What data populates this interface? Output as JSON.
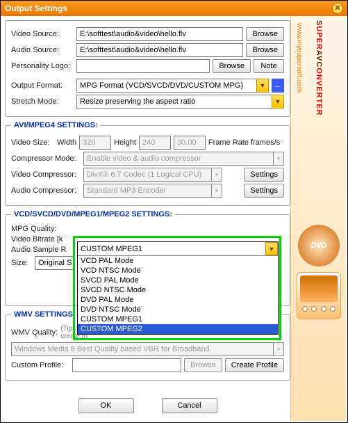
{
  "window": {
    "title": "Output Settings"
  },
  "brand": {
    "name_a": "S",
    "name_b": "UPER",
    "name_c": "AVC",
    "name_d": "ONVERTER",
    "url": "www.mysupersoft.com",
    "dvd": "DVD"
  },
  "top": {
    "video_source_label": "Video Source:",
    "video_source_value": "E:\\softtest\\audio&video\\hello.flv",
    "audio_source_label": "Audio Source:",
    "audio_source_value": "E:\\softtest\\audio&video\\hello.flv",
    "personality_logo_label": "Personality Logo:",
    "personality_logo_value": "",
    "browse": "Browse",
    "note": "Note",
    "output_format_label": "Output Format:",
    "output_format_value": "MPG Format (VCD/SVCD/DVD/CUSTOM MPG)",
    "stretch_mode_label": "Stretch Mode:",
    "stretch_mode_value": "Resize preserving the aspect ratio"
  },
  "avi": {
    "legend": "AVI/MPEG4 SETTINGS:",
    "video_size": "Video Size:",
    "width": "Width",
    "width_val": "320",
    "height": "Height",
    "height_val": "240",
    "fps_val": "30.00",
    "fps_label": "Frame Rate frames/s",
    "compressor_mode": "Compressor Mode:",
    "compressor_mode_val": "Enable video & audio compressor",
    "video_compressor": "Video Compressor:",
    "video_compressor_val": "DivX® 6.7 Codec (1 Logical CPU)",
    "audio_compressor": "Audio Compressor:",
    "audio_compressor_val": "Standard MP3 Encoder",
    "settings": "Settings"
  },
  "mpg": {
    "legend": "VCD/SVCD/DVD/MPEG1/MPEG2 SETTINGS:",
    "quality": "MPG Quality:",
    "quality_selected": "CUSTOM MPEG1",
    "bitrate": "Video Bitrate [k",
    "sample": "Audio Sample R",
    "size": "Size:",
    "size_val": "Original S",
    "options": [
      "VCD PAL Mode",
      "VCD NTSC Mode",
      "SVCD PAL Mode",
      "SVCD NTSC Mode",
      "DVD PAL Mode",
      "DVD NTSC Mode",
      "CUSTOM MPEG1",
      "CUSTOM MPEG2"
    ],
    "highlighted": "CUSTOM MPEG2"
  },
  "wmv": {
    "legend": "WMV SETTINGS:",
    "quality": "WMV Quality:",
    "hint": "(Tips: 'Custom Profile' contains WMV9 profiles, you can browse or create it)",
    "profile_val": "Windows Media 8 Best Quality based VBR for Broadband.",
    "custom_profile": "Custom Profile:",
    "custom_profile_val": "",
    "browse": "Browse",
    "create": "Create Profile"
  },
  "buttons": {
    "ok": "OK",
    "cancel": "Cancel"
  }
}
